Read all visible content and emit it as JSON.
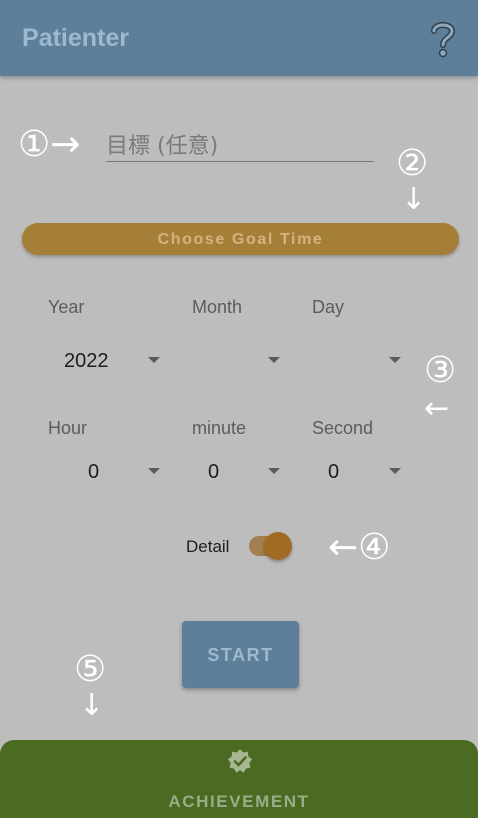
{
  "app": {
    "title": "Patienter",
    "help_icon": "question-mark-icon"
  },
  "callouts": {
    "one": "①→",
    "two": "②",
    "two_arrow": "↓",
    "three": "③",
    "three_arrow": "←",
    "four": "←④",
    "five": "⑤",
    "five_arrow": "↓"
  },
  "goal": {
    "placeholder": "目標 (任意)",
    "value": ""
  },
  "goal_time_button": {
    "label": "Choose Goal Time"
  },
  "date": {
    "year": {
      "label": "Year",
      "value": "2022"
    },
    "month": {
      "label": "Month",
      "value": ""
    },
    "day": {
      "label": "Day",
      "value": ""
    }
  },
  "time": {
    "hour": {
      "label": "Hour",
      "value": "0"
    },
    "minute": {
      "label": "minute",
      "value": "0"
    },
    "second": {
      "label": "Second",
      "value": "0"
    }
  },
  "detail": {
    "label": "Detail",
    "on": true
  },
  "start_button": {
    "label": "START"
  },
  "bottom_tab": {
    "label": "ACHIEVEMENT",
    "icon": "verified-badge-icon"
  },
  "colors": {
    "app_bar": "#5e7f99",
    "accent": "#a57f38",
    "bottom_tab": "#4b6b22"
  }
}
